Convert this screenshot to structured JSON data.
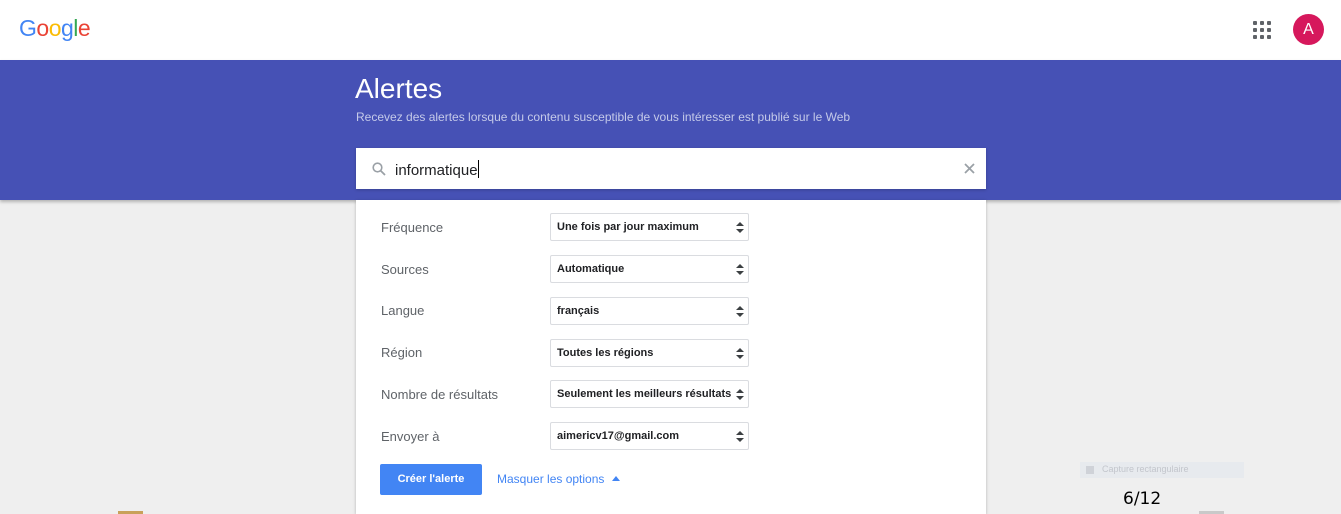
{
  "header": {
    "logo_letters": [
      {
        "char": "G",
        "color": "#4285f4"
      },
      {
        "char": "o",
        "color": "#ea4335"
      },
      {
        "char": "o",
        "color": "#fbbc05"
      },
      {
        "char": "g",
        "color": "#4285f4"
      },
      {
        "char": "l",
        "color": "#34a853"
      },
      {
        "char": "e",
        "color": "#ea4335"
      }
    ],
    "apps_icon": "apps-grid-icon",
    "avatar_letter": "A",
    "avatar_color": "#d6185c"
  },
  "hero": {
    "title": "Alertes",
    "subtitle": "Recevez des alertes lorsque du contenu susceptible de vous intéresser est publié sur le Web",
    "background": "#4651b5"
  },
  "search": {
    "value": "informatique",
    "search_icon": "search-icon",
    "clear_icon": "close-icon"
  },
  "options": [
    {
      "label": "Fréquence",
      "value": "Une fois par jour maximum"
    },
    {
      "label": "Sources",
      "value": "Automatique"
    },
    {
      "label": "Langue",
      "value": "français"
    },
    {
      "label": "Région",
      "value": "Toutes les régions"
    },
    {
      "label": "Nombre de résultats",
      "value": "Seulement les meilleurs résultats"
    },
    {
      "label": "Envoyer à",
      "value": "aimericv17@gmail.com"
    }
  ],
  "actions": {
    "create_label": "Créer l'alerte",
    "hide_options_label": "Masquer les options",
    "accent": "#4285f4"
  },
  "overlay": {
    "snip_label": "Capture rectangulaire",
    "page_counter": "6/12"
  }
}
